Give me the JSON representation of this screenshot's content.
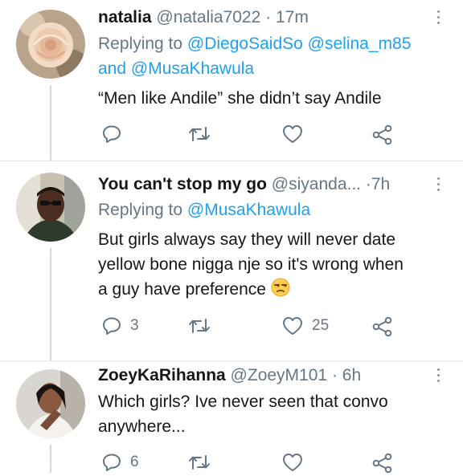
{
  "tweets": [
    {
      "display_name": "natalia",
      "handle": "@natalia7022",
      "time": "17m",
      "reply_prefix": "Replying to",
      "reply_line1_mentions": [
        "@DiegoSaidSo",
        "@selina_m85"
      ],
      "reply_line2_and": "and",
      "reply_line2_mention": "@MusaKhawula",
      "text_lines": [
        "“Men like Andile” she didn’t say Andile"
      ],
      "reply_count": "",
      "retweet_count": "",
      "like_count": ""
    },
    {
      "display_name": "You can't stop my go",
      "handle": "@siyanda...",
      "time": "7h",
      "reply_prefix": "Replying to",
      "reply_mention": "@MusaKhawula",
      "text_lines": [
        "But girls always say they will never date",
        "yellow bone nigga nje so it's wrong when",
        "a guy have preference"
      ],
      "emoji": "unamused-face",
      "reply_count": "3",
      "retweet_count": "",
      "like_count": "25"
    },
    {
      "display_name": "ZoeyKaRihanna",
      "handle": "@ZoeyM101",
      "time": "6h",
      "text_lines": [
        "Which girls? Ive never seen that convo",
        "anywhere..."
      ],
      "reply_count": "6",
      "retweet_count": "",
      "like_count": ""
    }
  ],
  "separator": "·",
  "icons": [
    "reply-icon",
    "retweet-icon",
    "like-icon",
    "share-icon",
    "more-icon"
  ],
  "colors": {
    "mention": "#1da1f2",
    "meta": "#657786",
    "text": "#14171a",
    "divider": "#e1e8ed"
  }
}
